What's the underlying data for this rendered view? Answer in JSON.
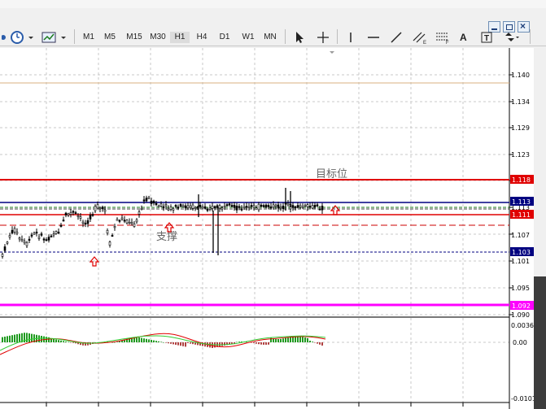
{
  "toolbar": {
    "timeframes": [
      "M1",
      "M5",
      "M15",
      "M30",
      "H1",
      "H4",
      "D1",
      "W1",
      "MN"
    ],
    "active_timeframe": "H1",
    "label_a": "A"
  },
  "chart": {
    "price_axis_ticks": [
      "1.140",
      "1.134",
      "1.129",
      "1.123",
      "1.118",
      "1.113",
      "1.107",
      "1.101",
      "1.095",
      "1.090"
    ],
    "indicator_axis_ticks": [
      "0.0036",
      "0.00",
      "-0.0101"
    ],
    "annotations": {
      "target": "目标位",
      "support": "支撑"
    },
    "level_labels": {
      "red_top": "1.118",
      "blue_top": "1.113",
      "red_mid": "1.111",
      "blue_bottom": "1.103",
      "magenta": "1.092"
    },
    "colors": {
      "red_level": "#e00000",
      "blue_level": "#000080",
      "magenta_level": "#ff00ff",
      "dashed_red": "#cc0000",
      "macd_up": "#1f9a1f",
      "macd_down": "#b04040",
      "signal": "#e00000"
    }
  }
}
